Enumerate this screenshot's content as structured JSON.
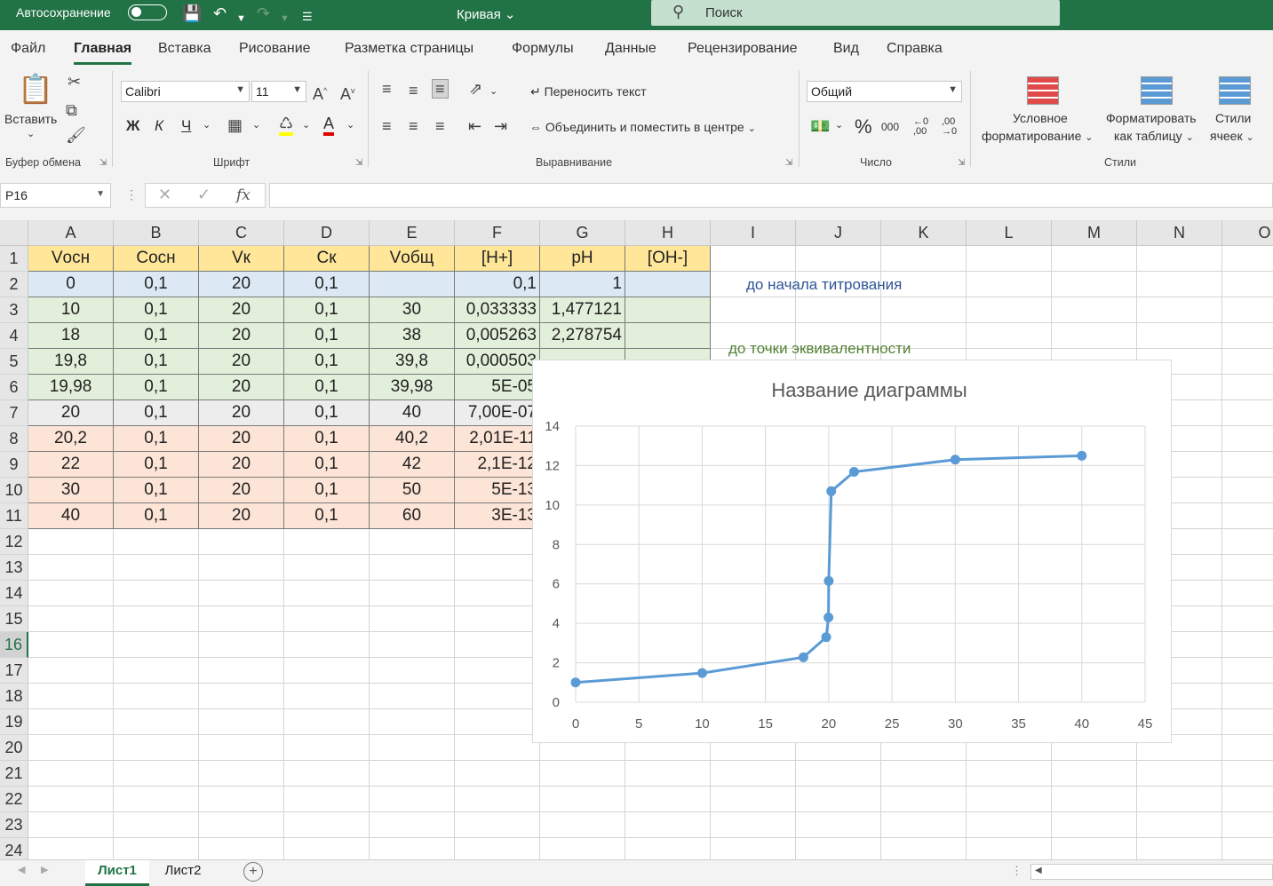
{
  "titlebar": {
    "autosave_label": "Автосохранение",
    "document_title": "Кривая",
    "search_placeholder": "Поиск",
    "accent_color": "#217346"
  },
  "menu": {
    "tabs": [
      "Файл",
      "Главная",
      "Вставка",
      "Рисование",
      "Разметка страницы",
      "Формулы",
      "Данные",
      "Рецензирование",
      "Вид",
      "Справка"
    ],
    "active_tab": "Главная"
  },
  "ribbon": {
    "clipboard": {
      "paste_label": "Вставить",
      "group_label": "Буфер обмена"
    },
    "font": {
      "name": "Calibri",
      "size": "11",
      "bold": "Ж",
      "italic": "К",
      "underline": "Ч",
      "group_label": "Шрифт"
    },
    "alignment": {
      "wrap_text": "Переносить текст",
      "merge_center": "Объединить и поместить в центре",
      "group_label": "Выравнивание"
    },
    "number": {
      "format": "Общий",
      "percent": "%",
      "thousands": "000",
      "group_label": "Число"
    },
    "styles": {
      "conditional_line1": "Условное",
      "conditional_line2": "форматирование",
      "format_table_line1": "Форматировать",
      "format_table_line2": "как таблицу",
      "cell_styles_line1": "Стили",
      "cell_styles_line2": "ячеек",
      "group_label": "Стили"
    }
  },
  "formula_bar": {
    "name_box": "P16",
    "fx": "fx",
    "formula": ""
  },
  "columns": [
    "A",
    "B",
    "C",
    "D",
    "E",
    "F",
    "G",
    "H",
    "I",
    "J",
    "K",
    "L",
    "M",
    "N",
    "O"
  ],
  "rows": [
    "1",
    "2",
    "3",
    "4",
    "5",
    "6",
    "7",
    "8",
    "9",
    "10",
    "11",
    "12",
    "13",
    "14",
    "15",
    "16",
    "17",
    "18",
    "19",
    "20",
    "21",
    "22",
    "23",
    "24"
  ],
  "selected_row": "16",
  "table": {
    "headers": [
      "Vосн",
      "Сосн",
      "Vк",
      "Ск",
      "Vобщ",
      "[H+]",
      "pH",
      "[OH-]"
    ],
    "rows": [
      [
        "0",
        "0,1",
        "20",
        "0,1",
        "",
        "0,1",
        "1",
        ""
      ],
      [
        "10",
        "0,1",
        "20",
        "0,1",
        "30",
        "0,033333",
        "1,477121",
        ""
      ],
      [
        "18",
        "0,1",
        "20",
        "0,1",
        "38",
        "0,005263",
        "2,278754",
        ""
      ],
      [
        "19,8",
        "0,1",
        "20",
        "0,1",
        "39,8",
        "0,000503",
        "",
        ""
      ],
      [
        "19,98",
        "0,1",
        "20",
        "0,1",
        "39,98",
        "5E-05",
        "",
        ""
      ],
      [
        "20",
        "0,1",
        "20",
        "0,1",
        "40",
        "7,00E-07",
        "",
        ""
      ],
      [
        "20,2",
        "0,1",
        "20",
        "0,1",
        "40,2",
        "2,01E-11",
        "",
        ""
      ],
      [
        "22",
        "0,1",
        "20",
        "0,1",
        "42",
        "2,1E-12",
        "",
        ""
      ],
      [
        "30",
        "0,1",
        "20",
        "0,1",
        "50",
        "5E-13",
        "",
        ""
      ],
      [
        "40",
        "0,1",
        "20",
        "0,1",
        "60",
        "3E-13",
        "",
        ""
      ]
    ],
    "row_colors": [
      "#dce9f5",
      "#e2efda",
      "#e2efda",
      "#e2efda",
      "#e2efda",
      "#ededed",
      "#fce4d6",
      "#fce4d6",
      "#fce4d6",
      "#fce4d6"
    ],
    "header_color": "#ffe699"
  },
  "notes": {
    "before_titration": "до начала титрования",
    "before_equivalence": "до точки эквивалентности",
    "before_color": "#2f5597",
    "equivalence_color": "#548235"
  },
  "chart_data": {
    "type": "scatter",
    "title": "Название диаграммы",
    "xlim": [
      0,
      45
    ],
    "ylim": [
      0,
      14
    ],
    "x_ticks": [
      "0",
      "5",
      "10",
      "15",
      "20",
      "25",
      "30",
      "35",
      "40",
      "45"
    ],
    "y_ticks": [
      "0",
      "2",
      "4",
      "6",
      "8",
      "10",
      "12",
      "14"
    ],
    "grid": true,
    "series_color": "#5b9bd5",
    "series": [
      {
        "x": [
          0,
          10,
          18,
          19.8,
          19.98,
          20,
          20.2,
          22,
          30,
          40
        ],
        "y": [
          1,
          1.48,
          2.28,
          3.3,
          4.3,
          6.15,
          10.7,
          11.68,
          12.3,
          12.5
        ]
      }
    ]
  },
  "sheets": {
    "tabs": [
      "Лист1",
      "Лист2"
    ],
    "active": "Лист1"
  }
}
